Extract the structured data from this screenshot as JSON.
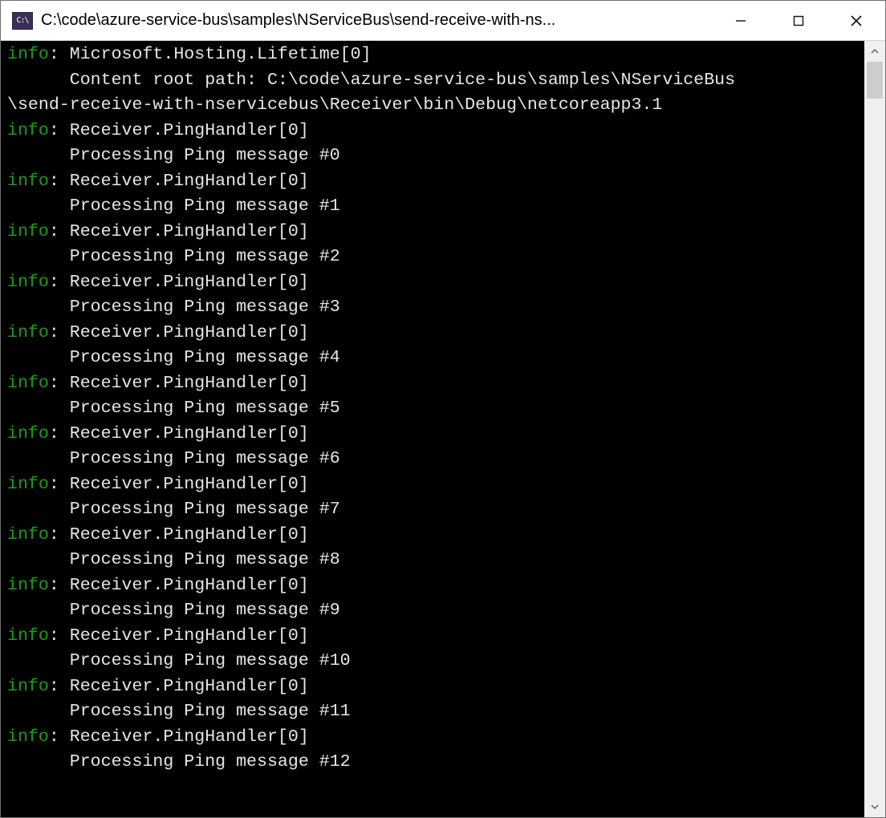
{
  "window": {
    "title": "C:\\code\\azure-service-bus\\samples\\NServiceBus\\send-receive-with-ns...",
    "icon_label": "C:\\"
  },
  "log": {
    "first": {
      "level": "info",
      "source": "Microsoft.Hosting.Lifetime[0]",
      "message_line1": "Content root path: C:\\code\\azure-service-bus\\samples\\NServiceBus",
      "message_line2": "\\send-receive-with-nservicebus\\Receiver\\bin\\Debug\\netcoreapp3.1"
    },
    "entries": [
      {
        "level": "info",
        "source": "Receiver.PingHandler[0]",
        "message": "Processing Ping message #0"
      },
      {
        "level": "info",
        "source": "Receiver.PingHandler[0]",
        "message": "Processing Ping message #1"
      },
      {
        "level": "info",
        "source": "Receiver.PingHandler[0]",
        "message": "Processing Ping message #2"
      },
      {
        "level": "info",
        "source": "Receiver.PingHandler[0]",
        "message": "Processing Ping message #3"
      },
      {
        "level": "info",
        "source": "Receiver.PingHandler[0]",
        "message": "Processing Ping message #4"
      },
      {
        "level": "info",
        "source": "Receiver.PingHandler[0]",
        "message": "Processing Ping message #5"
      },
      {
        "level": "info",
        "source": "Receiver.PingHandler[0]",
        "message": "Processing Ping message #6"
      },
      {
        "level": "info",
        "source": "Receiver.PingHandler[0]",
        "message": "Processing Ping message #7"
      },
      {
        "level": "info",
        "source": "Receiver.PingHandler[0]",
        "message": "Processing Ping message #8"
      },
      {
        "level": "info",
        "source": "Receiver.PingHandler[0]",
        "message": "Processing Ping message #9"
      },
      {
        "level": "info",
        "source": "Receiver.PingHandler[0]",
        "message": "Processing Ping message #10"
      },
      {
        "level": "info",
        "source": "Receiver.PingHandler[0]",
        "message": "Processing Ping message #11"
      },
      {
        "level": "info",
        "source": "Receiver.PingHandler[0]",
        "message": "Processing Ping message #12"
      }
    ]
  }
}
